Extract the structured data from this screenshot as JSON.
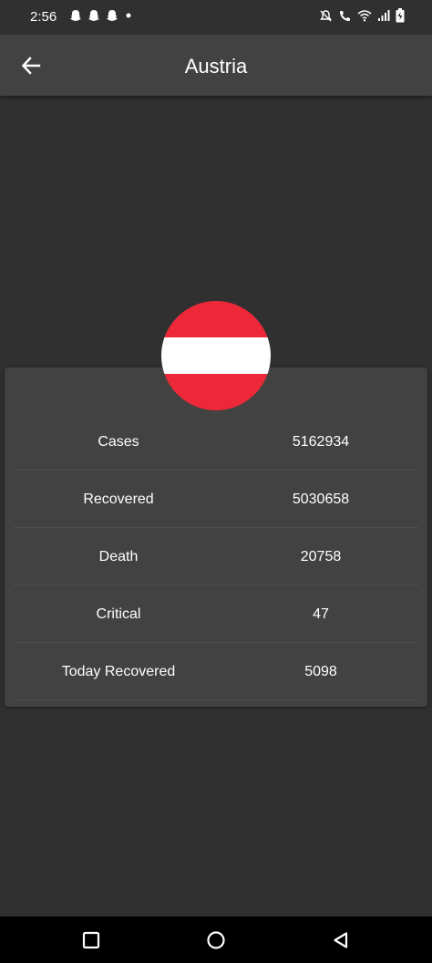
{
  "status_bar": {
    "time": "2:56",
    "left_icons": [
      "snapchat-icon",
      "snapchat-icon",
      "snapchat-icon",
      "dot-icon"
    ],
    "right_icons": [
      "mute-icon",
      "wifi-calling-icon",
      "wifi-icon",
      "signal-icon",
      "battery-charging-icon"
    ]
  },
  "app_bar": {
    "title": "Austria",
    "back_icon": "arrow-left-icon"
  },
  "flag": {
    "country": "Austria",
    "colors": [
      "#ED2939",
      "#FFFFFF",
      "#ED2939"
    ]
  },
  "stats": {
    "rows": [
      {
        "label": "Cases",
        "value": "5162934"
      },
      {
        "label": "Recovered",
        "value": "5030658"
      },
      {
        "label": "Death",
        "value": "20758"
      },
      {
        "label": "Critical",
        "value": "47"
      },
      {
        "label": "Today Recovered",
        "value": "5098"
      }
    ]
  },
  "nav_bar": {
    "buttons": [
      "recents-square-icon",
      "home-circle-icon",
      "back-triangle-icon"
    ]
  },
  "theme": {
    "background": "#303030",
    "card": "#424242",
    "text": "#FFFFFF"
  }
}
